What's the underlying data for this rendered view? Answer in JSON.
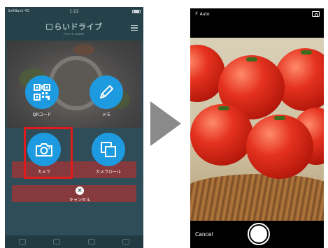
{
  "left_screen": {
    "status_bar": {
      "carrier": "SoftBank 4G",
      "time": "1:22"
    },
    "header": {
      "logo_text": "らいドライブ",
      "logo_subtitle": "PHOTO DIARY"
    },
    "overlay_menu": {
      "qr": {
        "label": "QRコード",
        "icon": "qr-code-icon"
      },
      "memo": {
        "label": "メモ",
        "icon": "pencil-icon"
      },
      "camera": {
        "label": "カメラ",
        "icon": "camera-icon"
      },
      "camera_roll": {
        "label": "カメラロール",
        "icon": "copy-squares-icon"
      },
      "cancel": {
        "label": "キャンセル",
        "icon": "close-icon"
      }
    },
    "highlight_color": "#e01b1b",
    "accent_color": "#1e9be0"
  },
  "right_screen": {
    "flash_label": "Auto",
    "cancel_label": "Cancel",
    "icons": {
      "flash": "flash-icon",
      "switch_camera": "switch-camera-icon",
      "shutter": "shutter-button"
    }
  }
}
